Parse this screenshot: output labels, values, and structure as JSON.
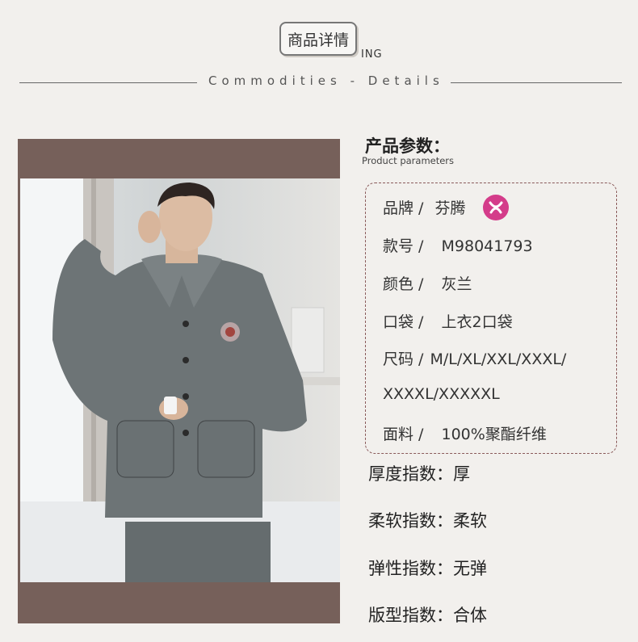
{
  "header": {
    "badge_text": "商品详情",
    "badge_suffix": "ING",
    "subtitle": "Commodities - Details"
  },
  "params": {
    "heading": "产品参数：",
    "heading_en": "Product parameters",
    "brand_label": "品牌 /",
    "brand_value": "芬腾",
    "item_no_label": "款号 /",
    "item_no_value": "M98041793",
    "color_label": "颜色 /",
    "color_value": "灰兰",
    "pocket_label": "口袋 /",
    "pocket_value": "上衣2口袋",
    "size_label": "尺码 /",
    "size_value_1": "M/L/XL/XXL/XXXL/",
    "size_value_2": "XXXXL/XXXXXL",
    "fabric_label": "面料 /",
    "fabric_value": "100%聚酯纤维"
  },
  "indices": {
    "thickness": "厚度指数：厚",
    "softness": "柔软指数：柔软",
    "elasticity": "弹性指数：无弹",
    "fit": "版型指数：合体"
  },
  "colors": {
    "frame": "#76605a",
    "pajama": "#6d7476",
    "brand_logo": "#d43c8a"
  }
}
